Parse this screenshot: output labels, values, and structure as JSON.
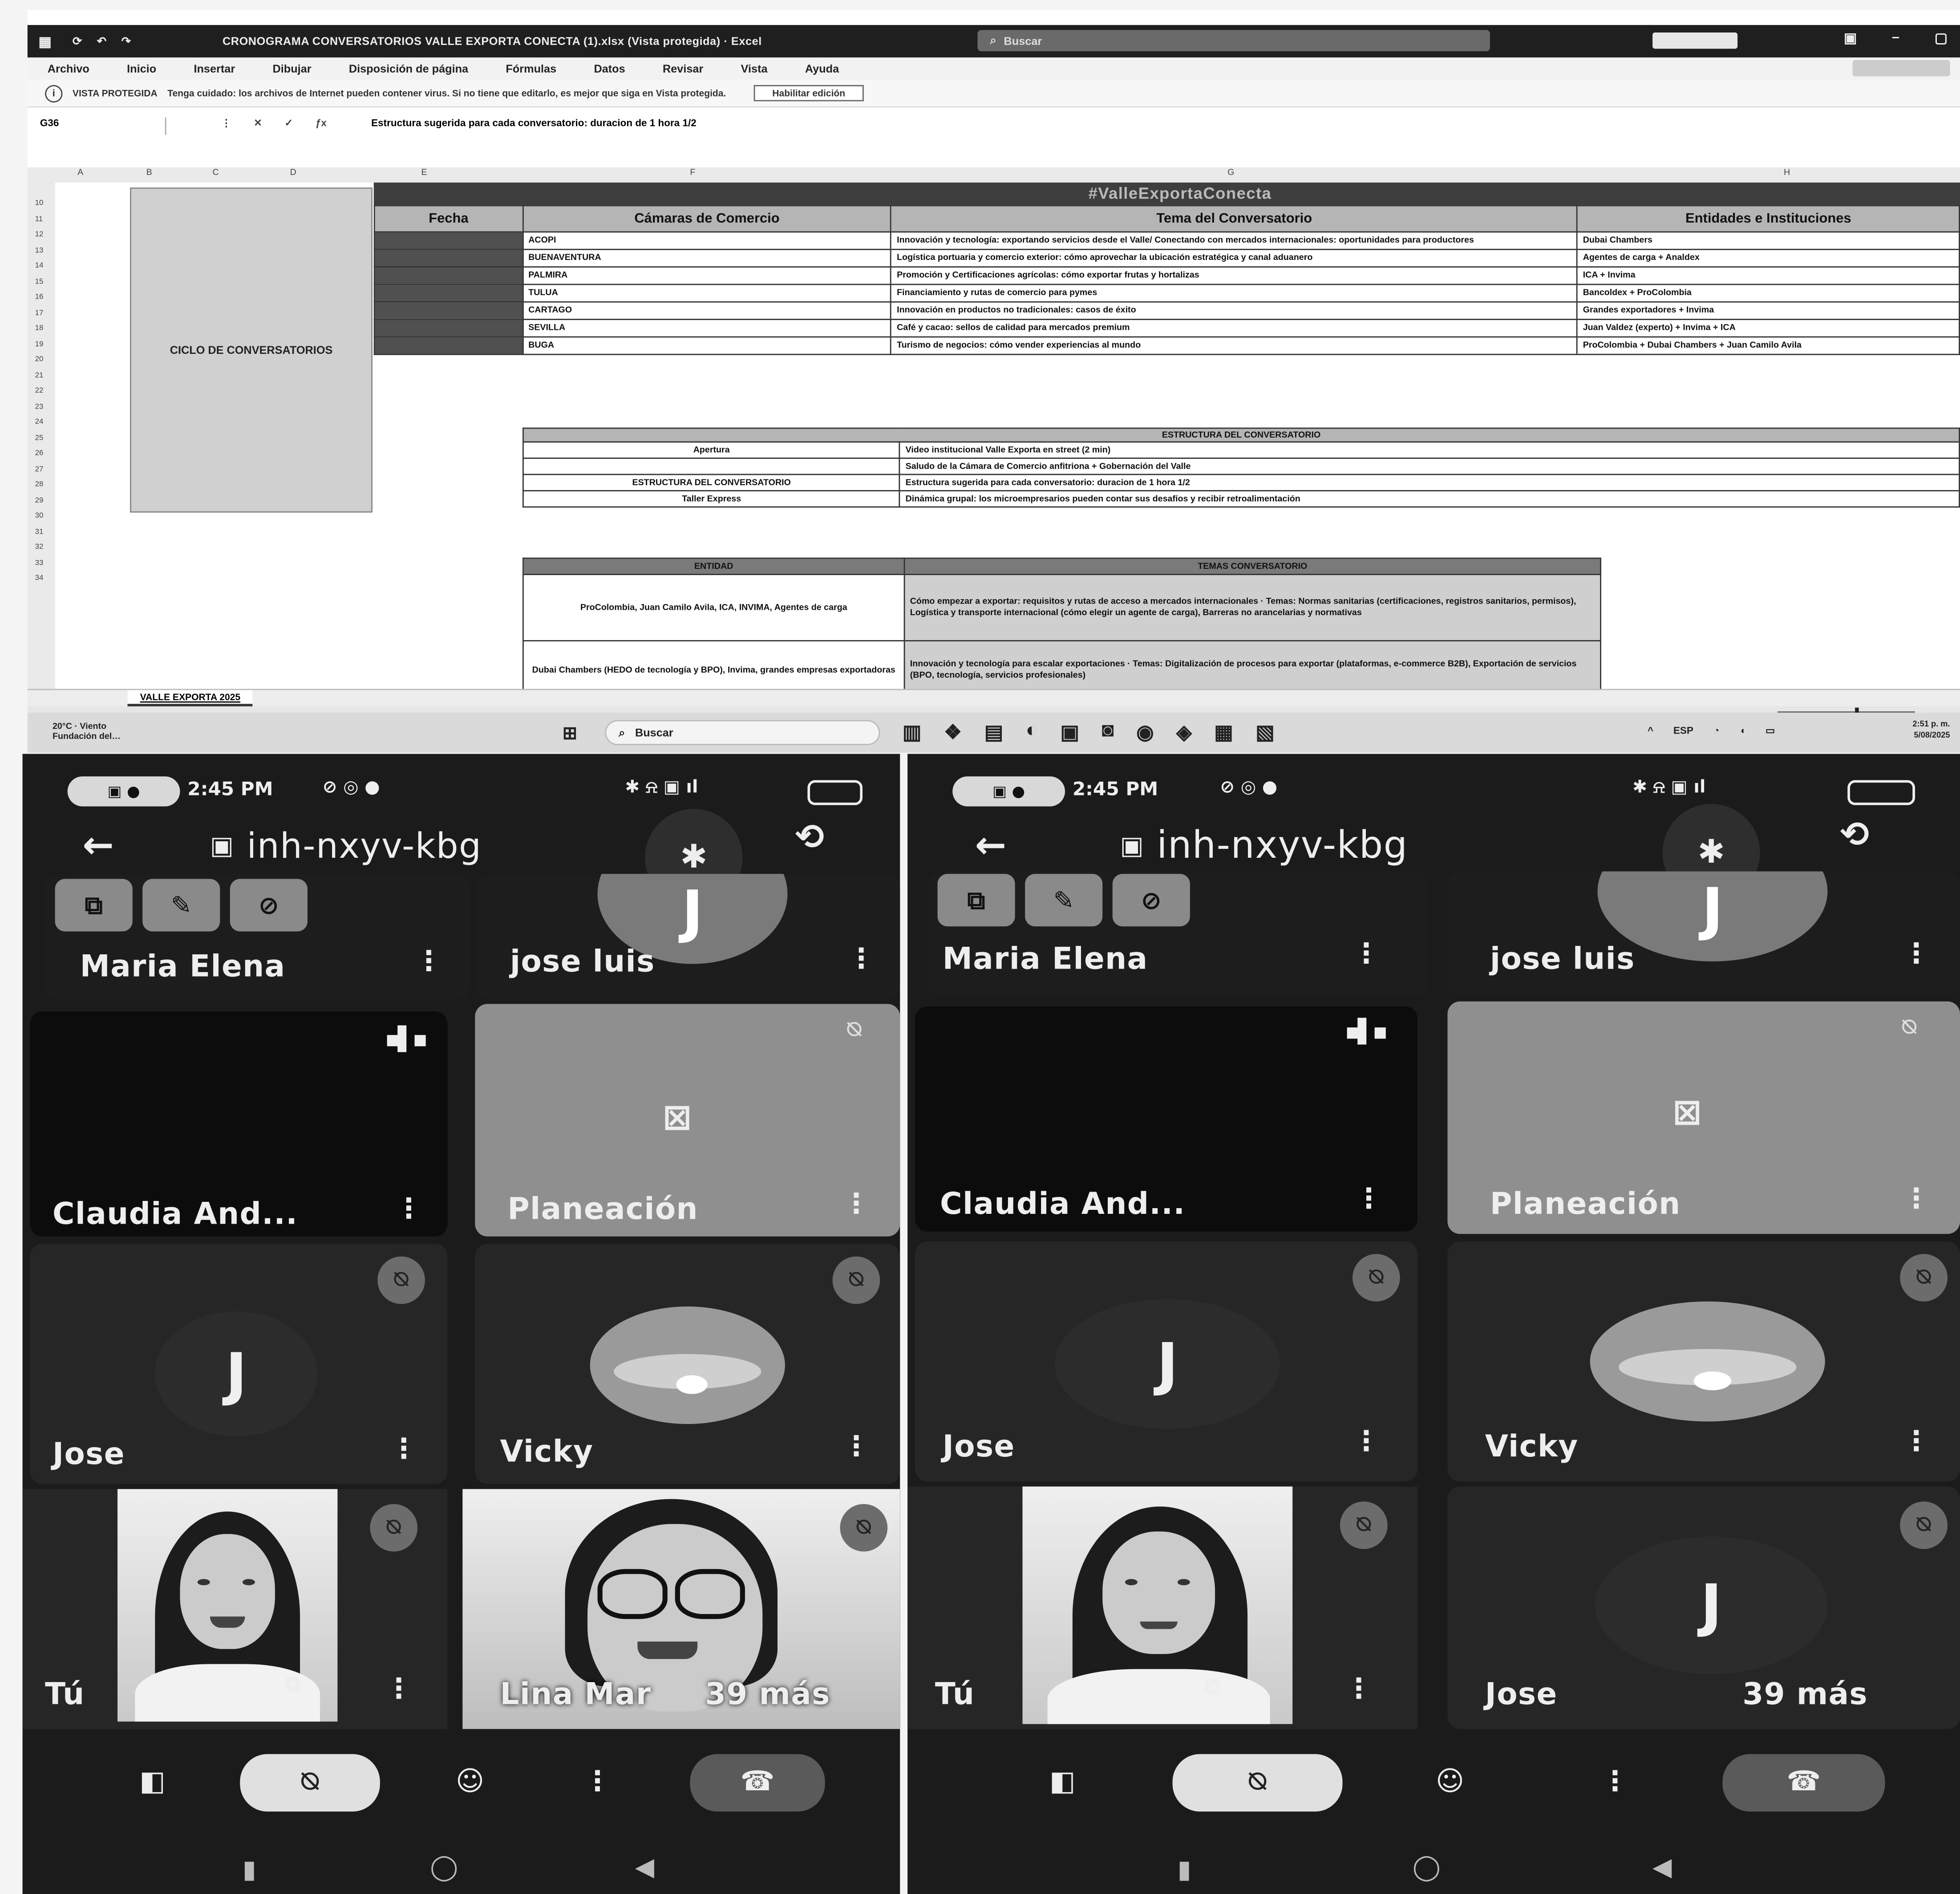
{
  "excel": {
    "title": "CRONOGRAMA CONVERSATORIOS VALLE EXPORTA CONECTA (1).xlsx (Vista protegida) · Excel",
    "search_placeholder": "Buscar",
    "menu": [
      "Archivo",
      "Inicio",
      "Insertar",
      "Dibujar",
      "Disposición de página",
      "Fórmulas",
      "Datos",
      "Revisar",
      "Vista",
      "Ayuda"
    ],
    "protected_label": "VISTA PROTEGIDA",
    "protected_msg": "Tenga cuidado: los archivos de Internet pueden contener virus. Si no tiene que editarlo, es mejor que siga en Vista protegida.",
    "enable_button": "Habilitar edición",
    "name_box": "G36",
    "formula": "Estructura sugerida para cada conversatorio: duracion de 1 hora 1/2",
    "cols": [
      "A",
      "B",
      "C",
      "D",
      "E",
      "F",
      "G",
      "H"
    ],
    "rows": [
      "10",
      "11",
      "12",
      "13",
      "14",
      "15",
      "16",
      "17",
      "18",
      "19",
      "20",
      "21",
      "22",
      "23",
      "24",
      "25",
      "26",
      "27",
      "28",
      "29",
      "30",
      "31",
      "32",
      "33",
      "34"
    ],
    "side_label": "CICLO DE CONVERSATORIOS",
    "hashtag": "#ValleExportaConecta",
    "schedule_headers": [
      "Fecha",
      "Cámaras de Comercio",
      "Tema del Conversatorio",
      "Entidades e Instituciones"
    ],
    "schedule": [
      {
        "c": "ACOPI",
        "t": "Innovación y tecnología: exportando servicios desde el Valle/ Conectando con mercados internacionales: oportunidades para productores",
        "e": "Dubai Chambers"
      },
      {
        "c": "BUENAVENTURA",
        "t": "Logística portuaria y comercio exterior: cómo aprovechar la ubicación estratégica y canal aduanero",
        "e": "Agentes de carga + Analdex"
      },
      {
        "c": "PALMIRA",
        "t": "Promoción y Certificaciones agrícolas: cómo exportar frutas y hortalizas",
        "e": "ICA + Invima"
      },
      {
        "c": "TULUA",
        "t": "Financiamiento y rutas de comercio para pymes",
        "e": "Bancoldex + ProColombia"
      },
      {
        "c": "CARTAGO",
        "t": "Innovación en productos no tradicionales: casos de éxito",
        "e": "Grandes exportadores + Invima"
      },
      {
        "c": "SEVILLA",
        "t": "Café y cacao: sellos de calidad para mercados premium",
        "e": "Juan Valdez (experto) + Invima + ICA"
      },
      {
        "c": "BUGA",
        "t": "Turismo de negocios: cómo vender experiencias al mundo",
        "e": "ProColombia + Dubai Chambers + Juan Camilo Avila"
      }
    ],
    "structure_title": "ESTRUCTURA DEL CONVERSATORIO",
    "structure": [
      {
        "l": "Apertura",
        "r": "Video institucional Valle Exporta en street (2 min)"
      },
      {
        "l": "",
        "r": "Saludo de la Cámara de Comercio anfitriona + Gobernación del Valle"
      },
      {
        "l": "ESTRUCTURA DEL CONVERSATORIO",
        "r": "Estructura sugerida para cada conversatorio: duracion de 1 hora 1/2"
      },
      {
        "l": "Taller Express",
        "r": "Dinámica grupal: los microempresarios pueden contar sus desafíos y recibir retroalimentación"
      }
    ],
    "entities_headers": [
      "ENTIDAD",
      "TEMAS CONVERSATORIO"
    ],
    "entities": [
      {
        "l": "ProColombia, Juan Camilo Avila, ICA, INVIMA, Agentes de carga",
        "r": "Cómo empezar a exportar: requisitos y rutas de acceso a mercados internacionales · Temas: Normas sanitarias (certificaciones, registros sanitarios, permisos), Logística y transporte internacional (cómo elegir un agente de carga), Barreras no arancelarias y normativas"
      },
      {
        "l": "Dubai Chambers (HEDO de tecnología y BPO), Invima, grandes empresas exportadoras",
        "r": "Innovación y tecnología para escalar exportaciones · Temas: Digitalización de procesos para exportar (plataformas, e-commerce B2B), Exportación de servicios (BPO, tecnología, servicios profesionales)"
      }
    ],
    "sheet_tab": "VALLE EXPORTA 2025"
  },
  "taskbar": {
    "weather": "20°C · Viento",
    "weather2": "Fundación del…",
    "search": "Buscar",
    "lang": "ESP",
    "time": "2:51 p. m.",
    "date": "5/08/2025"
  },
  "phone1": {
    "time": "2:45 PM",
    "code": "inh-nxyv-kbg",
    "tiles": {
      "maria": "Maria Elena",
      "jose_luis": "jose luis",
      "claudia": "Claudia And...",
      "planeacion": "Planeación",
      "jose": "Jose",
      "vicky": "Vicky",
      "tu": "Tú",
      "lina": "Lina Mar",
      "more": "39 más"
    },
    "avatar_letter": "J"
  },
  "phone2": {
    "time": "2:45 PM",
    "code": "inh-nxyv-kbg",
    "tiles": {
      "maria": "Maria Elena",
      "jose_luis": "jose luis",
      "claudia": "Claudia And...",
      "planeacion": "Planeación",
      "jose": "Jose",
      "vicky": "Vicky",
      "tu": "Tú",
      "jose2": "Jose",
      "more": "39 más"
    },
    "avatar_letter": "J"
  }
}
